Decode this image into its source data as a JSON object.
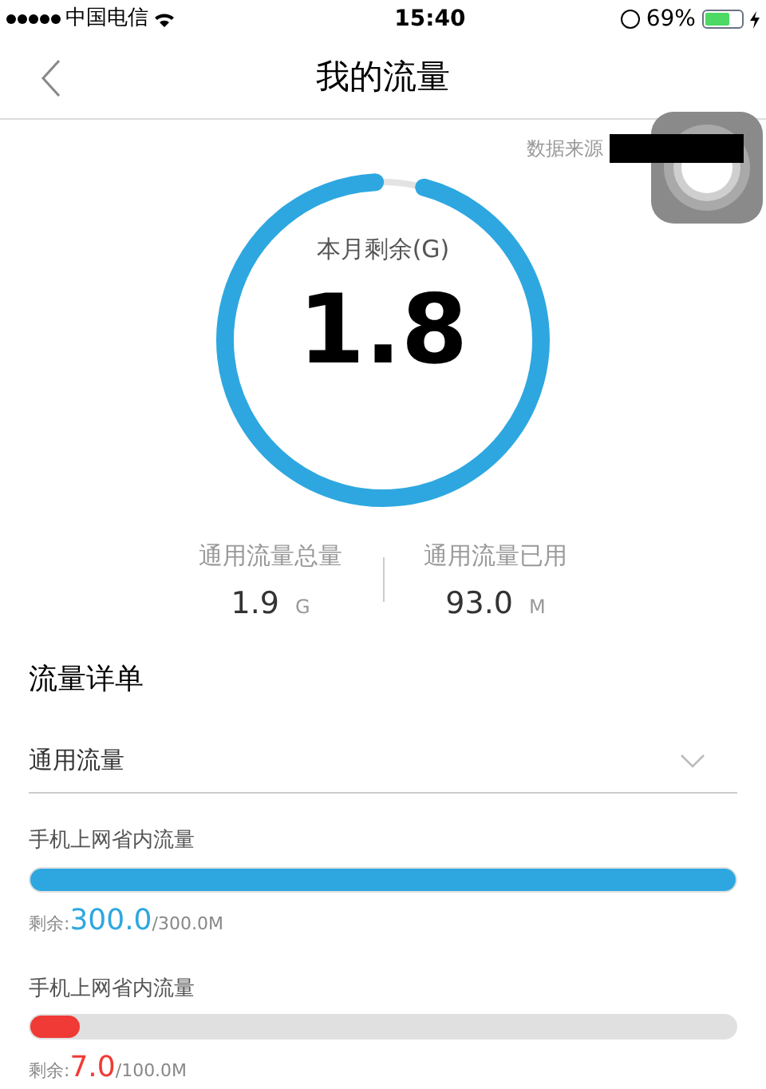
{
  "status_bar": {
    "carrier": "中国电信",
    "time": "15:40",
    "battery": "69%"
  },
  "nav": {
    "title": "我的流量"
  },
  "data_source": {
    "label": "数据来源"
  },
  "gauge": {
    "label": "本月剩余(G)",
    "value": "1.8",
    "level": 0.95
  },
  "stats": [
    {
      "label": "通用流量总量",
      "value": "1.9",
      "unit": "G"
    },
    {
      "label": "通用流量已用",
      "value": "93.0",
      "unit": "M"
    }
  ],
  "section_title": "流量详单",
  "dropdown": {
    "value": "通用流量"
  },
  "packages": [
    {
      "name": "手机上网省内流量",
      "level": 1.0,
      "color": "#2ea7e0",
      "remain_label": "剩余:",
      "remain": "300.0",
      "total": "/300.0M"
    },
    {
      "name": "手机上网省内流量",
      "level": 0.07,
      "color": "#f03a35",
      "remain_label": "剩余:",
      "remain": "7.0",
      "total": "/100.0M"
    }
  ]
}
